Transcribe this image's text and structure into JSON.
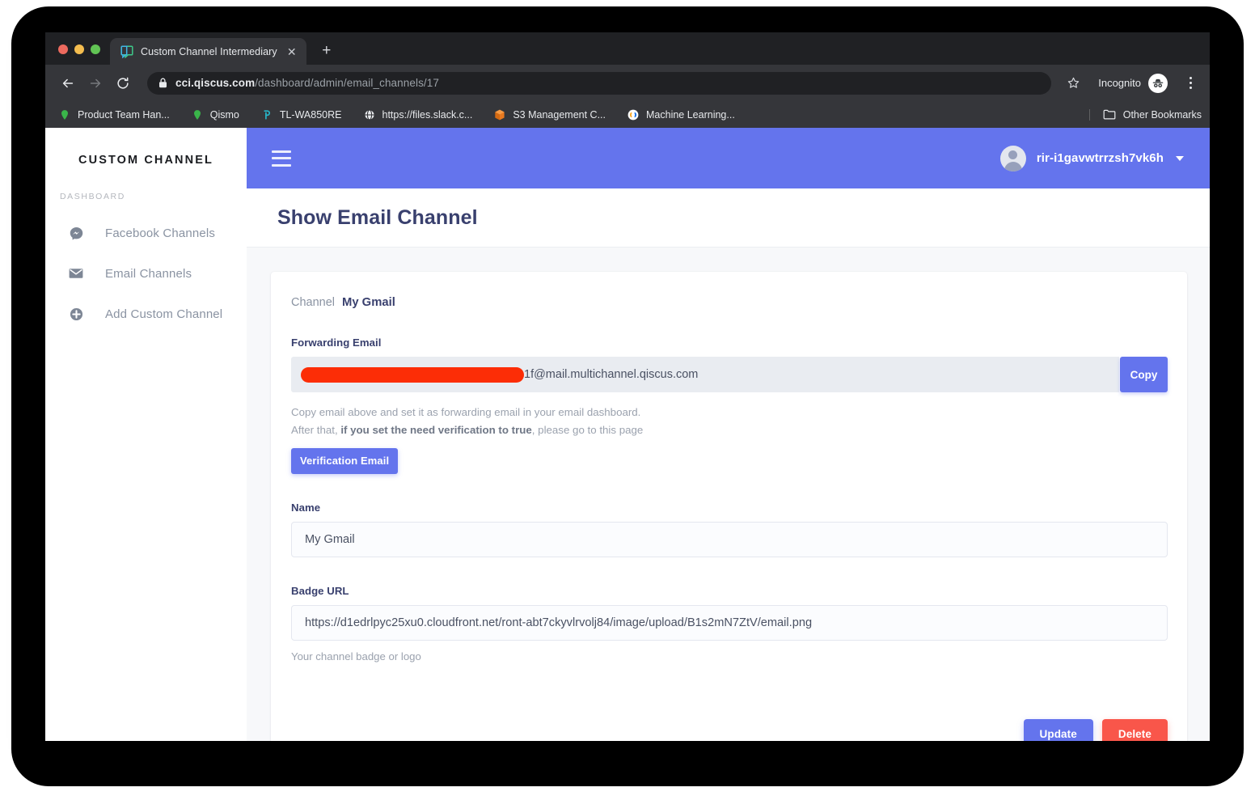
{
  "browser": {
    "tab": {
      "title": "Custom Channel Intermediary",
      "close_label": "✕",
      "favicon_name": "qiscus-chat-favicon"
    },
    "new_tab_label": "+",
    "omnibox": {
      "domain": "cci.qiscus.com",
      "path": "/dashboard/admin/email_channels/17"
    },
    "incognito_label": "Incognito",
    "bookmarks": [
      {
        "label": "Product Team Han...",
        "icon": "green-location-pin-icon"
      },
      {
        "label": "Qismo",
        "icon": "green-location-pin-icon"
      },
      {
        "label": "TL-WA850RE",
        "icon": "tp-link-icon"
      },
      {
        "label": "https://files.slack.c...",
        "icon": "globe-icon"
      },
      {
        "label": "S3 Management C...",
        "icon": "aws-s3-cube-icon"
      },
      {
        "label": "Machine Learning...",
        "icon": "google-colab-icon"
      }
    ],
    "other_bookmarks_label": "Other Bookmarks"
  },
  "sidebar": {
    "brand": "CUSTOM CHANNEL",
    "section_label": "DASHBOARD",
    "items": [
      {
        "label": "Facebook Channels",
        "icon": "messenger-bubble-icon"
      },
      {
        "label": "Email Channels",
        "icon": "envelope-icon"
      },
      {
        "label": "Add Custom Channel",
        "icon": "plus-circle-icon"
      }
    ]
  },
  "appbar": {
    "menu_icon": "hamburger-menu-icon",
    "user_name": "rir-i1gavwtrrzsh7vk6h"
  },
  "page": {
    "title": "Show Email Channel",
    "channel_label": "Channel",
    "channel_name": "My Gmail",
    "forwarding_email": {
      "label": "Forwarding Email",
      "redacted_value": "",
      "visible_suffix": "1f@mail.multichannel.qiscus.com",
      "copy_button": "Copy"
    },
    "hint_line1": "Copy email above and set it as forwarding email in your email dashboard.",
    "hint_line2_prefix": "After that, ",
    "hint_line2_bold": "if you set the need verification to true",
    "hint_line2_suffix": ", please go to this page",
    "verification_button": "Verification Email",
    "name_field": {
      "label": "Name",
      "value": "My Gmail"
    },
    "badge_field": {
      "label": "Badge URL",
      "value": "https://d1edrlpyc25xu0.cloudfront.net/ront-abt7ckyvlrvolj84/image/upload/B1s2mN7ZtV/email.png",
      "hint": "Your channel badge or logo"
    },
    "update_button": "Update",
    "delete_button": "Delete"
  },
  "colors": {
    "accent_purple": "#6474ed",
    "danger_red": "#f9564a",
    "title_navy": "#39406e",
    "redaction_red": "#fc2d06"
  }
}
